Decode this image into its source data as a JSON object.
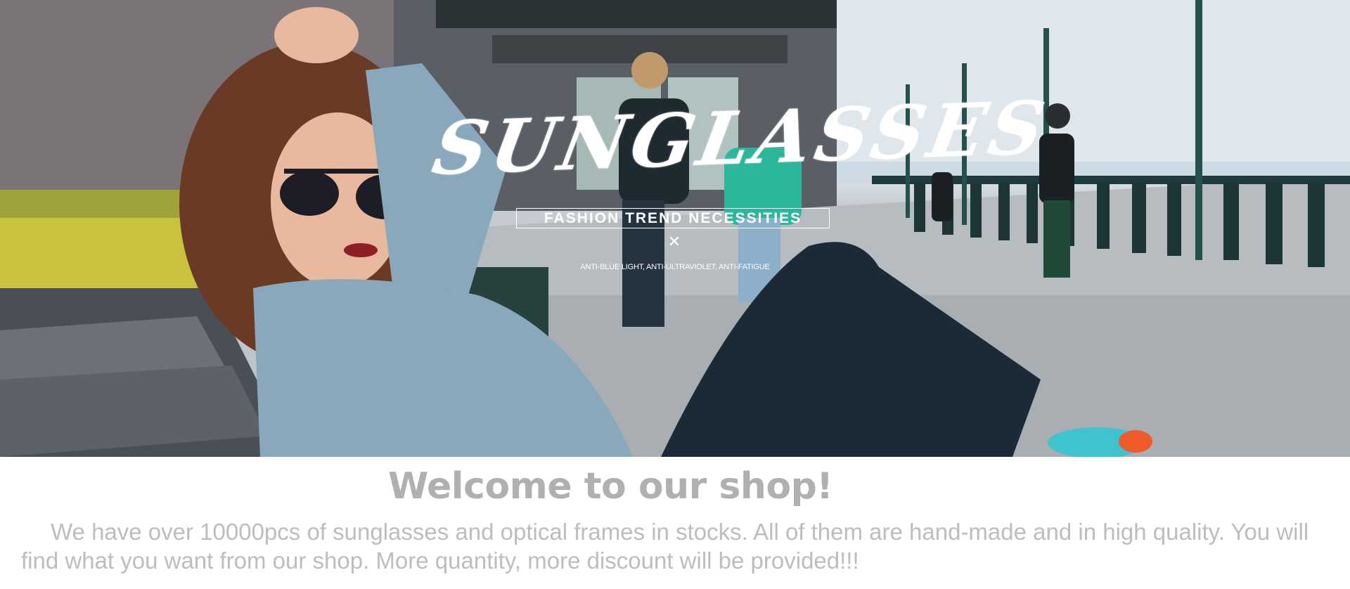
{
  "banner": {
    "title": "SUNGLASSES",
    "tagline": "FASHION TREND NECESSITIES",
    "close_glyph": "✕",
    "subtag": "ANTI-BLUE LIGHT, ANTI-ULTRAVIOLET, ANTI-FATIGUE",
    "image_icon": "photo-of-woman-in-sunglasses-on-bench",
    "colors": {
      "sky": "#d5dde3",
      "sweater": "#8ba9bc",
      "jeans": "#1c2a38",
      "teal": "#1e6f6a"
    }
  },
  "welcome": {
    "title": "Welcome to our shop!",
    "body": "We have over 10000pcs of sunglasses and optical frames in stocks. All of them are hand-made and in high quality. You will find what you want from our shop. More quantity, more discount will be provided!!!",
    "text_color": "#b0b0b0"
  }
}
